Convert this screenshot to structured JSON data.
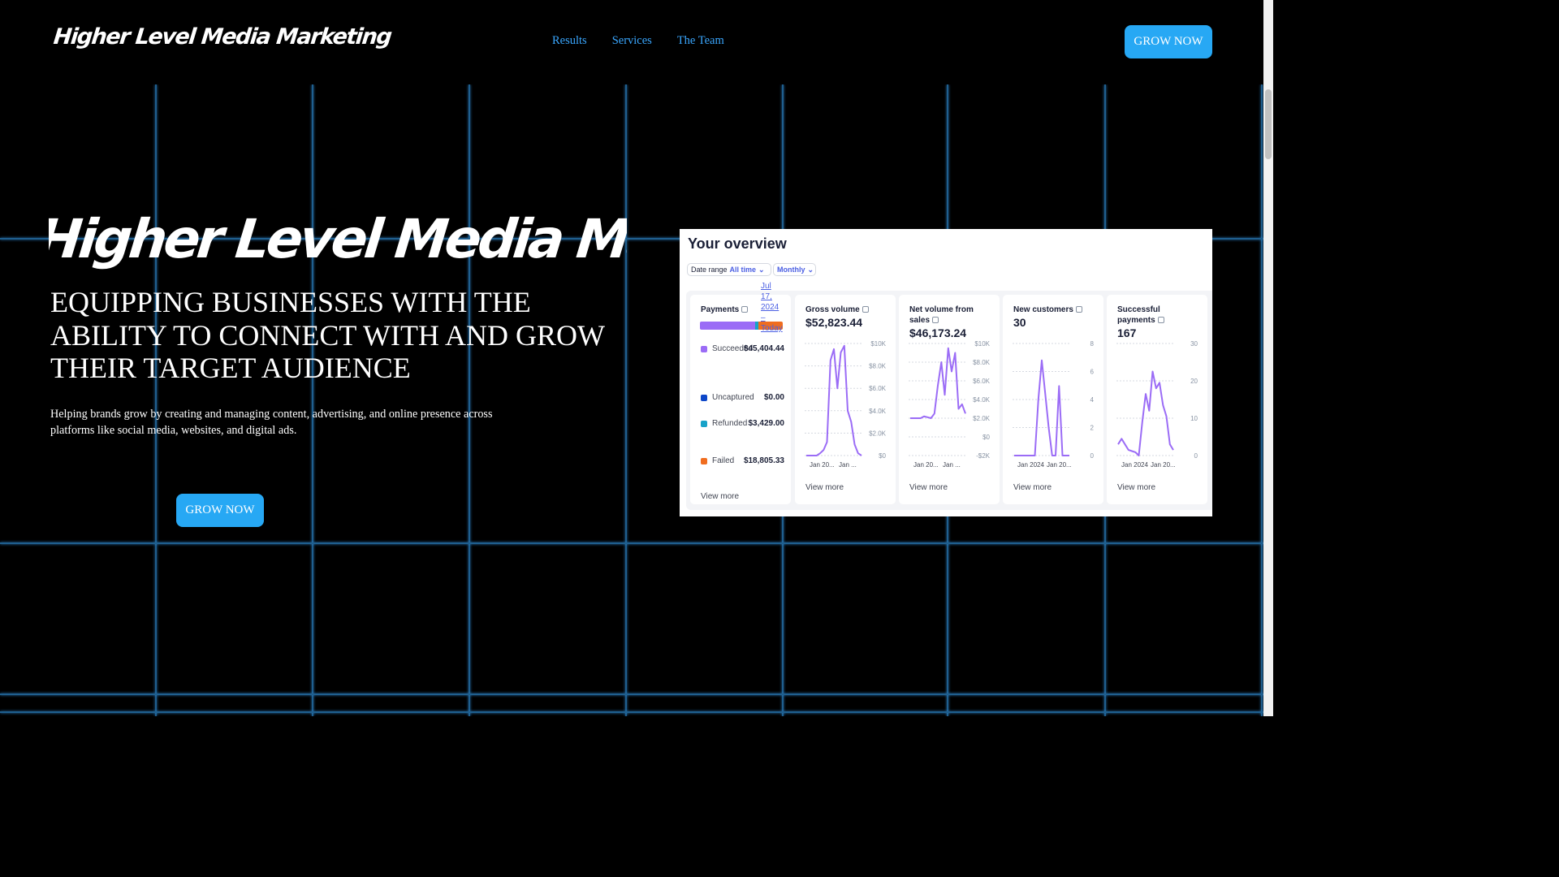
{
  "header": {
    "logo": "Higher Level Media Marketing",
    "nav": [
      "Results",
      "Services",
      "The Team"
    ],
    "cta": "GROW NOW"
  },
  "hero": {
    "brand": "Higher Level Media Marketing",
    "title": "EQUIPPING BUSINESSES WITH THE ABILITY TO CONNECT WITH AND GROW THEIR TARGET AUDIENCE",
    "subtitle": "Helping brands grow by creating and managing content, advertising, and online presence across platforms like social media, websites, and digital ads.",
    "cta": "GROW NOW"
  },
  "dashboard": {
    "title": "Your overview",
    "date_range_label": "Date range",
    "date_range_value": "All time",
    "interval_value": "Monthly",
    "date_link": "Jul 17, 2024 – Today",
    "payments": {
      "title": "Payments",
      "rows": [
        {
          "label": "Succeeded",
          "value": "$45,404.44",
          "color": "#9b6cf6"
        },
        {
          "label": "Uncaptured",
          "value": "$0.00",
          "color": "#0d47c8"
        },
        {
          "label": "Refunded",
          "value": "$3,429.00",
          "color": "#17a2c8"
        },
        {
          "label": "Failed",
          "value": "$18,805.33",
          "color": "#f06d1f"
        }
      ],
      "view_more": "View more"
    },
    "cards": [
      {
        "title": "Gross volume",
        "value": "$52,823.44",
        "y_ticks": [
          "$10K",
          "$8.0K",
          "$6.0K",
          "$4.0K",
          "$2.0K",
          "$0"
        ],
        "x_ticks": [
          "Jan 20...",
          "Jan ..."
        ],
        "view_more": "View more",
        "series": [
          0,
          0,
          0,
          0,
          0.02,
          0.05,
          0.12,
          0.85,
          0.95,
          0.6,
          0.92,
          0.98,
          0.4,
          0.3,
          0.1,
          0.02,
          0.0
        ]
      },
      {
        "title": "Net volume from sales",
        "value": "$46,173.24",
        "y_ticks": [
          "$10K",
          "$8.0K",
          "$6.0K",
          "$4.0K",
          "$2.0K",
          "$0",
          "-$2K"
        ],
        "x_ticks": [
          "Jan 20...",
          "Jan ..."
        ],
        "view_more": "View more",
        "series": [
          0.2,
          0.2,
          0.2,
          0.2,
          0.22,
          0.21,
          0.2,
          0.25,
          0.55,
          0.8,
          0.45,
          0.95,
          0.7,
          0.9,
          0.3,
          0.35,
          0.25
        ]
      },
      {
        "title": "New customers",
        "value": "30",
        "y_ticks": [
          "8",
          "6",
          "4",
          "2",
          "0"
        ],
        "x_ticks": [
          "Jan 2024",
          "Jan 20..."
        ],
        "view_more": "View more",
        "series": [
          0,
          0,
          0,
          0,
          0,
          0,
          0,
          0.5,
          0.85,
          0.55,
          0.25,
          0.0,
          0.0,
          0.62,
          0.0,
          0.0,
          0.0
        ]
      },
      {
        "title": "Successful payments",
        "value": "167",
        "y_ticks": [
          "30",
          "20",
          "10",
          "0"
        ],
        "x_ticks": [
          "Jan 2024",
          "Jan 20..."
        ],
        "view_more": "View more",
        "series": [
          0.1,
          0.15,
          0.1,
          0.05,
          0.04,
          0.03,
          0.0,
          0.3,
          0.55,
          0.4,
          0.75,
          0.6,
          0.65,
          0.45,
          0.35,
          0.1,
          0.05
        ]
      }
    ]
  },
  "colors": {
    "accent": "#27a8f4",
    "nav_link": "#3aa7ff",
    "grid": "#1f5f8f",
    "chart_line": "#9b6cf6"
  }
}
